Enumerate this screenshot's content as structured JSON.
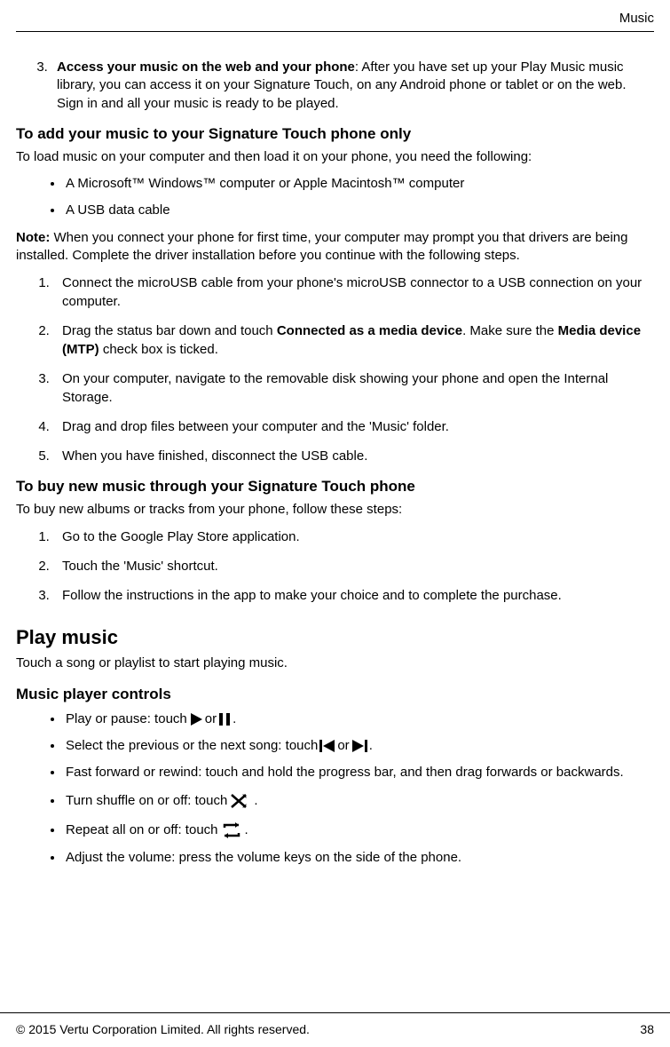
{
  "header": {
    "section": "Music"
  },
  "step3": {
    "bold": "Access your music on the web and your phone",
    "rest": ": After you have set up your Play Music music library, you can access it on your Signature Touch, on any Android phone or tablet or on the web. Sign in and all your music is ready to be played."
  },
  "add": {
    "heading": "To add your music to your Signature Touch phone only",
    "intro": "To load music on your computer and then load it on your phone, you need the following:",
    "req1": "A Microsoft™ Windows™ computer or Apple Macintosh™ computer",
    "req2": "A USB data cable",
    "note_label": "Note:",
    "note_body": " When you connect your phone for first time, your computer may prompt you that drivers are being installed. Complete the driver installation before you continue with the following steps.",
    "s1": "Connect the microUSB cable from your phone's microUSB connector to a USB connection on your computer.",
    "s2a": "Drag the status bar down and touch ",
    "s2b": "Connected as a media device",
    "s2c": ". Make sure the ",
    "s2d": "Media device (MTP)",
    "s2e": " check box is ticked.",
    "s3": "On your computer, navigate to the removable disk showing your phone and open the Internal Storage.",
    "s4": "Drag and drop files between your computer and the 'Music' folder.",
    "s5": "When you have finished, disconnect the USB cable."
  },
  "buy": {
    "heading": "To buy new music through your Signature Touch phone",
    "intro": "To buy new albums or tracks from your phone, follow these steps:",
    "s1": "Go to the Google Play Store application.",
    "s2": "Touch the 'Music' shortcut.",
    "s3": "Follow the instructions in the app to make your choice and to complete the purchase."
  },
  "play": {
    "heading": "Play music",
    "intro": "Touch a song or playlist to start playing music."
  },
  "controls": {
    "heading": "Music player controls",
    "c1a": "Play or pause: touch ",
    "c1_or": " or ",
    "c1_end": ".",
    "c2a": "Select the previous or the next song: touch ",
    "c2_or": " or ",
    "c2_end": ".",
    "c3": "Fast forward or rewind: touch and hold the progress bar, and then drag forwards or backwards.",
    "c4a": "Turn shuffle on or off: touch ",
    "c4_end": ".",
    "c5a": "Repeat all on or off: touch ",
    "c5_end": ".",
    "c6": "Adjust the volume: press the volume keys on the side of the phone."
  },
  "footer": {
    "copyright": "© 2015 Vertu Corporation Limited. All rights reserved.",
    "page": "38"
  }
}
